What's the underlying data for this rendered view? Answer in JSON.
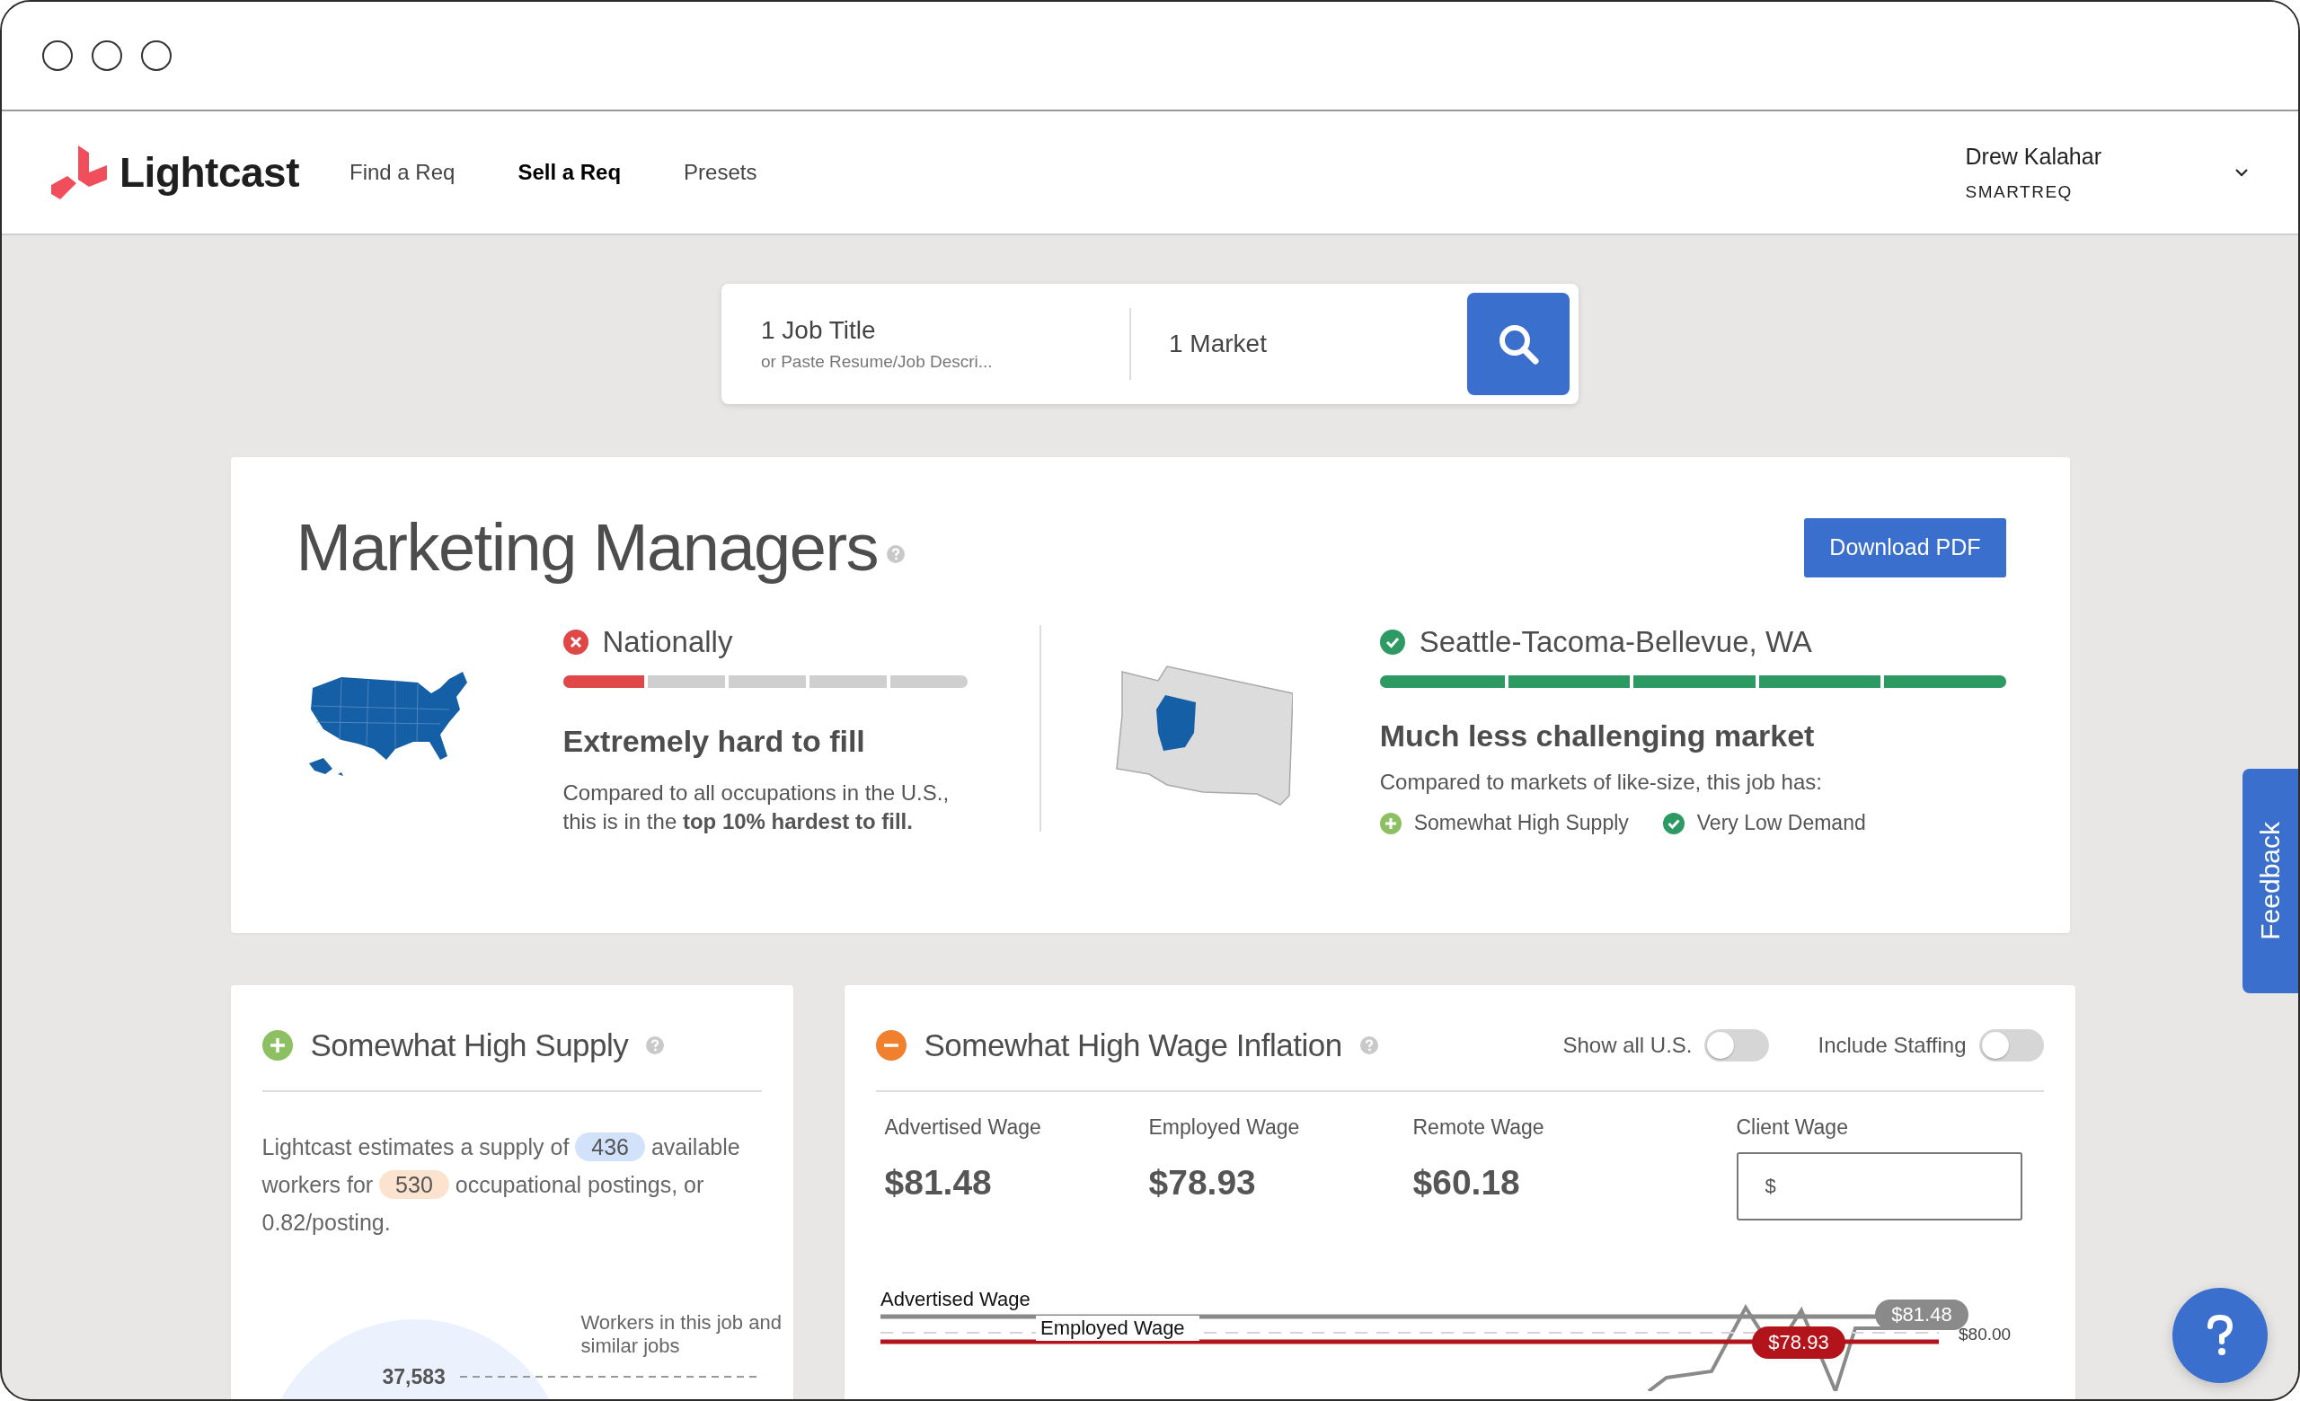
{
  "nav": {
    "logo": "Lightcast",
    "items": [
      {
        "label": "Find a Req",
        "selected": false
      },
      {
        "label": "Sell a Req",
        "selected": true
      },
      {
        "label": "Presets",
        "selected": false
      }
    ],
    "user": {
      "name": "Drew Kalahar",
      "role": "SMARTREQ"
    }
  },
  "search": {
    "job_title": {
      "value": "1 Job Title",
      "hint": "or Paste Resume/Job Descri..."
    },
    "market": {
      "value": "1 Market"
    }
  },
  "overview": {
    "title": "Marketing Managers",
    "download_button": "Download PDF",
    "markets": [
      {
        "kind": "fail",
        "map": {
          "kind": "us"
        },
        "name": "Nationally",
        "level": 0.2,
        "headline": "Extremely hard to fill",
        "description": "Compared to all occupations in the U.S., this is in the **top 10% hardest to fill.**"
      },
      {
        "kind": "pass",
        "map": {
          "kind": "state"
        },
        "name": "Seattle-Tacoma-Bellevue, WA",
        "level": 1,
        "headline": "Much less challenging market",
        "description": "Compared to markets of like-size, this job has:",
        "factors": [
          {
            "kind": "plus",
            "label": "Somewhat High Supply"
          },
          {
            "kind": "check",
            "label": "Very Low Demand"
          }
        ]
      }
    ]
  },
  "supply": {
    "kind": "plus",
    "title": "Somewhat High Supply",
    "text": [
      {
        "kind": "text",
        "text": "Lightcast estimates a supply of "
      },
      {
        "kind": "pill",
        "text": "436",
        "color": "#d3e2fb"
      },
      {
        "kind": "text",
        "text": " available workers for "
      },
      {
        "kind": "pill",
        "text": "530",
        "color": "#fbe3cf"
      },
      {
        "kind": "text",
        "text": " occupational postings, or 0.82/posting."
      }
    ],
    "chart": {
      "value_label": "37,583",
      "caption": "Workers in this job and similar jobs"
    }
  },
  "wages": {
    "kind": "minus",
    "title": "Somewhat High Wage Inflation",
    "toggles": [
      {
        "label": "Show all U.S.",
        "on": false
      },
      {
        "label": "Include Staffing",
        "on": false
      }
    ],
    "figures": [
      {
        "label": "Advertised Wage",
        "value": "$81.48"
      },
      {
        "label": "Employed Wage",
        "value": "$78.93"
      },
      {
        "label": "Remote Wage",
        "value": "$60.18"
      }
    ],
    "client_wage": {
      "label": "Client Wage",
      "placeholder": "$"
    },
    "chart": {
      "advertised_label": "Advertised Wage",
      "employed_label": "Employed Wage",
      "advertised_marker": "$81.48",
      "employed_marker": "$78.93",
      "axis_label": "$80.00"
    }
  },
  "feedback": "Feedback"
}
